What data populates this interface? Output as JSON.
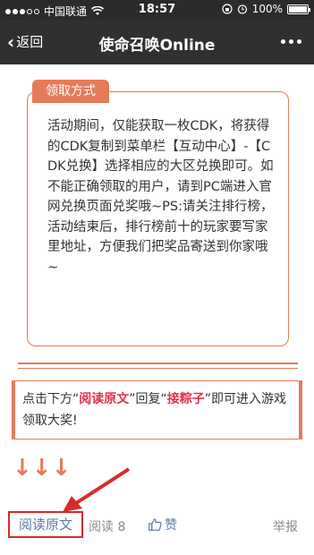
{
  "status_bar": {
    "carrier": "中国联通",
    "time": "18:57",
    "battery": "100%"
  },
  "nav": {
    "back_label": "返回",
    "title": "使命召唤Online"
  },
  "method": {
    "tab_label": "领取方式",
    "text": "活动期间，仅能获取一枚CDK，将获得的CDK复制到菜单栏【互动中心】-【CDK兑换】选择相应的大区兑换即可。如不能正确领取的用户，请到PC端进入官网兑换页面兑奖哦~PS:请关注排行榜，活动结束后，排行榜前十的玩家要写家里地址，方便我们把奖品寄送到你家哦~"
  },
  "cta": {
    "part1": "点击下方“",
    "highlight1": "阅读原文",
    "part2": "”回复“",
    "highlight2": "接粽子",
    "part3": "”即可进入游戏领取大奖!"
  },
  "arrows": "↓↓↓",
  "bottom": {
    "read_original": "阅读原文",
    "read_count": "阅读 8",
    "like_label": "赞",
    "report_label": "举报"
  },
  "colors": {
    "accent": "#e67b58",
    "highlight": "#e0334c",
    "link": "#5b7ca8",
    "annotation": "#d82a2a"
  }
}
